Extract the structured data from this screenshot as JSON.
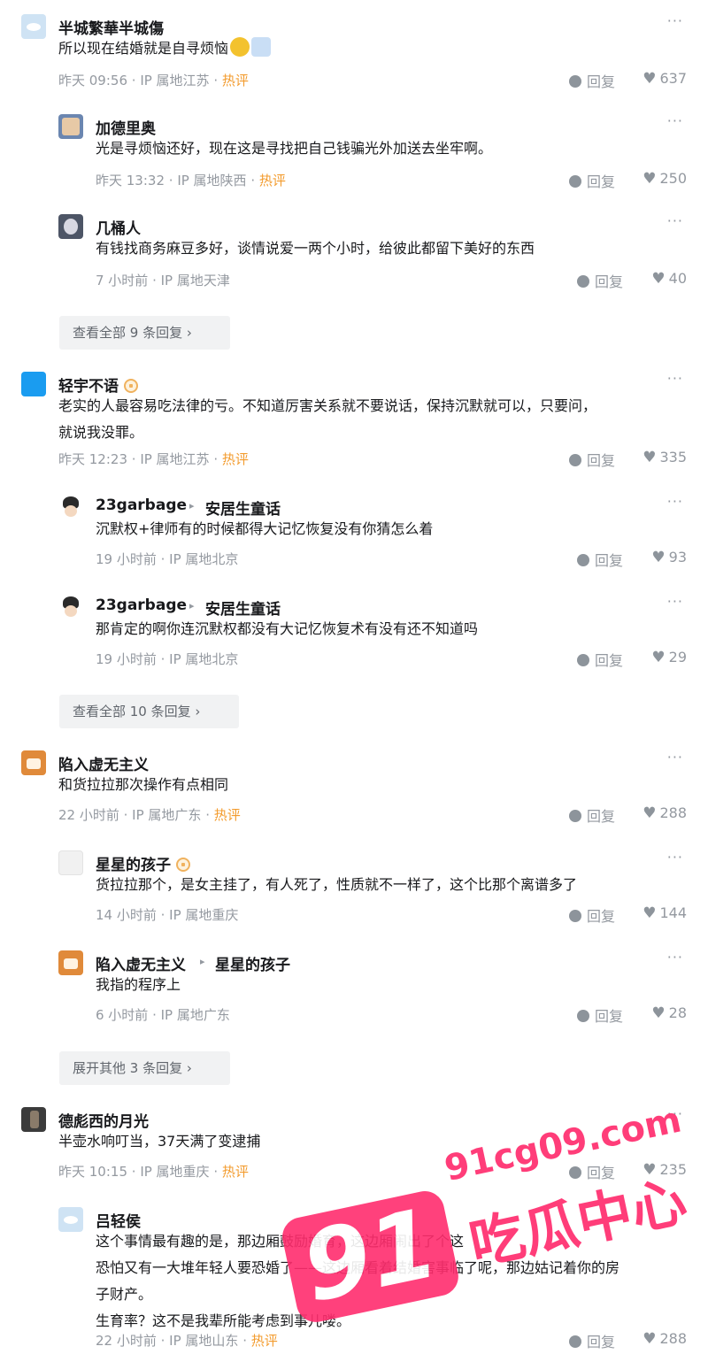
{
  "ui": {
    "more": "···",
    "reply": "回复",
    "sep": " · "
  },
  "c1": {
    "user": "半城繁華半城傷",
    "text": "所以现在结婚就是自寻烦恼",
    "time": "昨天 09:56",
    "ip": "IP 属地江苏",
    "hot": "热评",
    "likes": "637",
    "replies": [
      {
        "user": "加德里奥",
        "text": "光是寻烦恼还好，现在这是寻找把自己钱骗光外加送去坐牢啊。",
        "time": "昨天 13:32",
        "ip": "IP 属地陕西",
        "hot": "热评",
        "likes": "250"
      },
      {
        "user": "几桶人",
        "text": "有钱找商务麻豆多好，谈情说爱一两个小时，给彼此都留下美好的东西",
        "time": "7 小时前",
        "ip": "IP 属地天津",
        "likes": "40"
      }
    ],
    "view_all": "查看全部 9 条回复 ›"
  },
  "c2": {
    "user": "轻宇不语",
    "text1": "老实的人最容易吃法律的亏。不知道厉害关系就不要说话，保持沉默就可以，只要问，",
    "text2": "就说我没罪。",
    "time": "昨天 12:23",
    "ip": "IP 属地江苏",
    "hot": "热评",
    "likes": "335",
    "replies": [
      {
        "user": "23garbage",
        "arrow": "▸",
        "target": "安居生童话",
        "text": "沉默权+律师有的时候都得大记忆恢复没有你猜怎么着",
        "time": "19 小时前",
        "ip": "IP 属地北京",
        "likes": "93"
      },
      {
        "user": "23garbage",
        "arrow": "▸",
        "target": "安居生童话",
        "text": "那肯定的啊你连沉默权都没有大记忆恢复术有没有还不知道吗",
        "time": "19 小时前",
        "ip": "IP 属地北京",
        "likes": "29"
      }
    ],
    "view_all": "查看全部 10 条回复 ›"
  },
  "c3": {
    "user": "陷入虚无主义",
    "text": "和货拉拉那次操作有点相同",
    "time": "22 小时前",
    "ip": "IP 属地广东",
    "hot": "热评",
    "likes": "288",
    "replies": [
      {
        "user": "星星的孩子",
        "text": "货拉拉那个，是女主挂了，有人死了，性质就不一样了，这个比那个离谱多了",
        "time": "14 小时前",
        "ip": "IP 属地重庆",
        "likes": "144"
      },
      {
        "user": "陷入虚无主义",
        "arrow": "▸",
        "target": "星星的孩子",
        "text": "我指的程序上",
        "time": "6 小时前",
        "ip": "IP 属地广东",
        "likes": "28"
      }
    ],
    "view_all": "展开其他 3 条回复 ›"
  },
  "c4": {
    "user": "德彪西的月光",
    "text": "半壶水响叮当，37天满了变逮捕",
    "time": "昨天 10:15",
    "ip": "IP 属地重庆",
    "hot": "热评",
    "likes": "235",
    "replies": [
      {
        "user": "吕轻侯",
        "l1": "这个事情最有趣的是，那边厢鼓励婚育，这边厢闹出了个这",
        "l2": "恐怕又有一大堆年轻人要恐婚了——这边厢看着结婚害事临了呢，那边姑记着你的房",
        "l3": "子财产。",
        "l4": "生育率？这不是我辈所能考虑到事儿喽。",
        "time": "22 小时前",
        "ip": "IP 属地山东",
        "hot": "热评",
        "likes": "288"
      }
    ]
  },
  "watermark": {
    "url": "91cg09.com",
    "num": "91",
    "cn": "吃瓜中心",
    "color": "#ff2d6e"
  }
}
